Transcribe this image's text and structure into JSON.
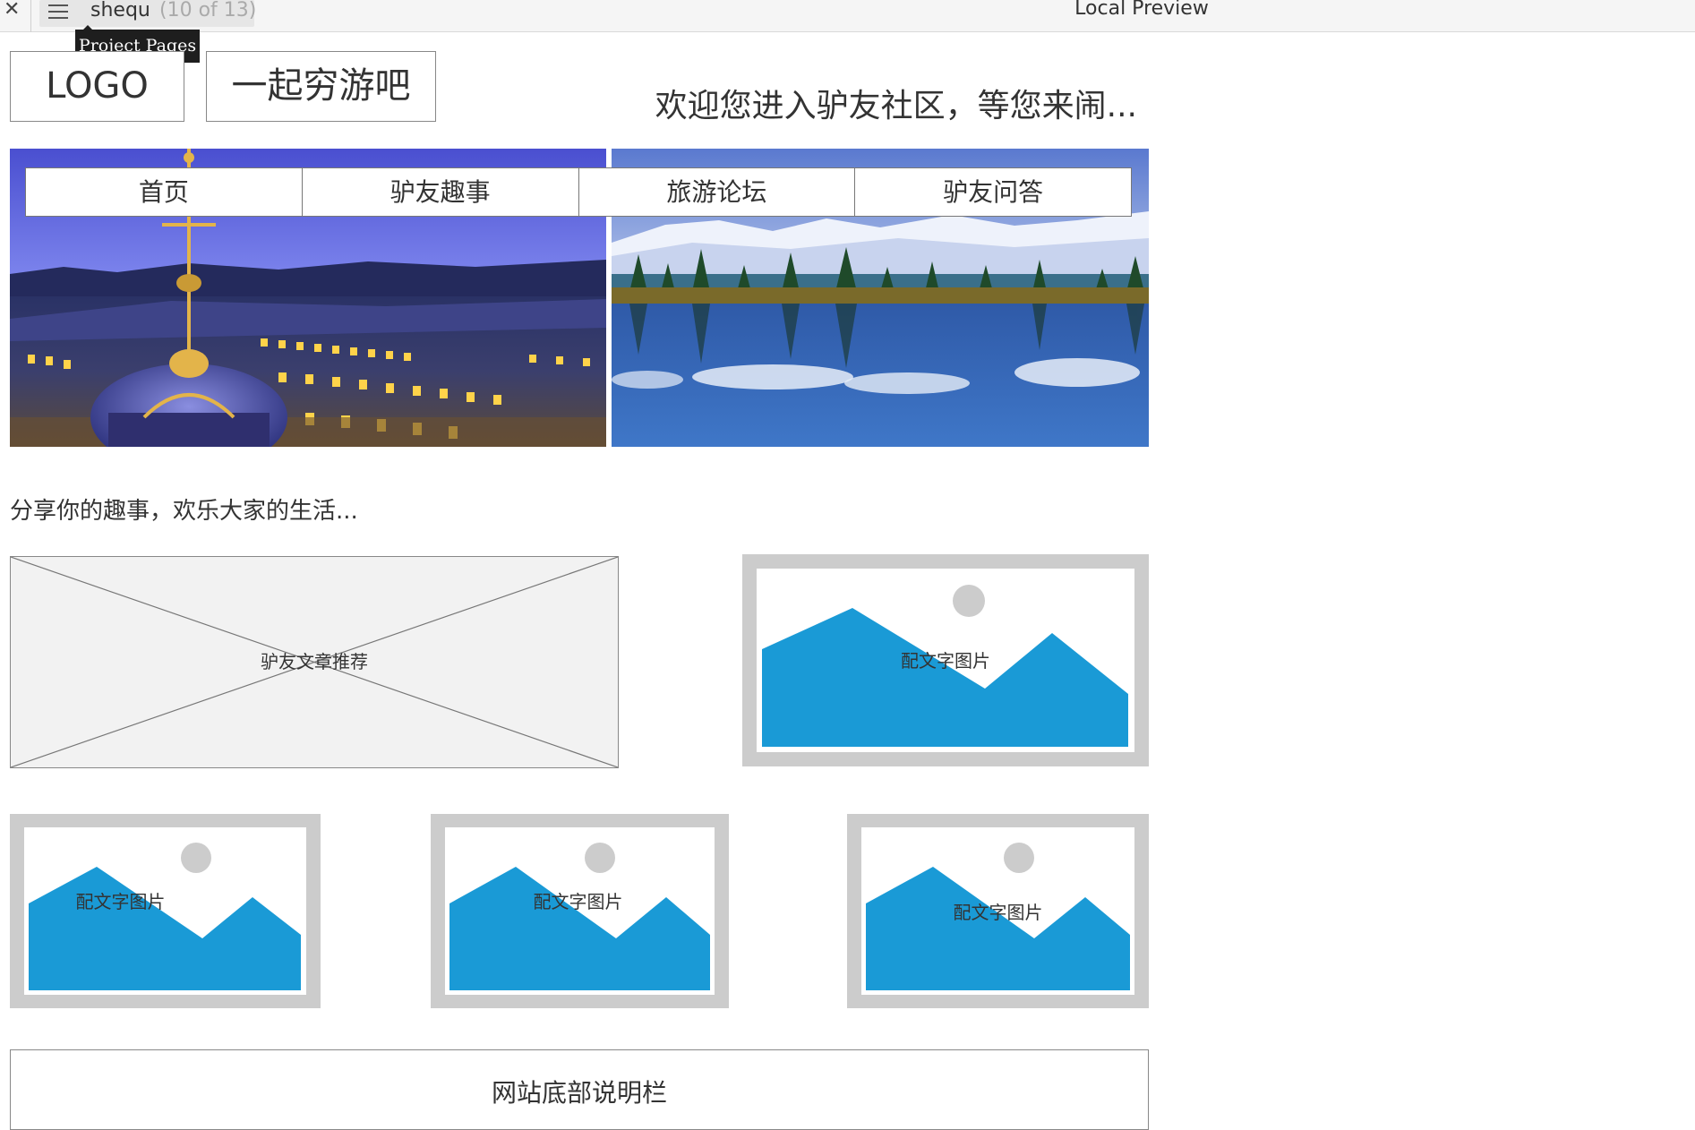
{
  "toolbar": {
    "close_icon": "close-icon",
    "menu_icon": "hamburger-menu-icon",
    "page_name": "shequ",
    "page_count": "(10 of 13)",
    "preview_title": "Local Preview",
    "tooltip": "Project Pages"
  },
  "header": {
    "logo": "LOGO",
    "site_name": "一起穷游吧",
    "welcome": "欢迎您进入驴友社区，等您来闹..."
  },
  "nav": {
    "items": [
      "首页",
      "驴友趣事",
      "旅游论坛",
      "驴友问答"
    ]
  },
  "content": {
    "share_text": "分享你的趣事，欢乐大家的生活...",
    "article_placeholder": "驴友文章推荐",
    "image_captions": [
      "配文字图片",
      "配文字图片",
      "配文字图片",
      "配文字图片"
    ]
  },
  "footer": {
    "text": "网站底部说明栏"
  },
  "colors": {
    "image_placeholder_blue": "#1a9ad6",
    "placeholder_frame": "#cccccc"
  }
}
